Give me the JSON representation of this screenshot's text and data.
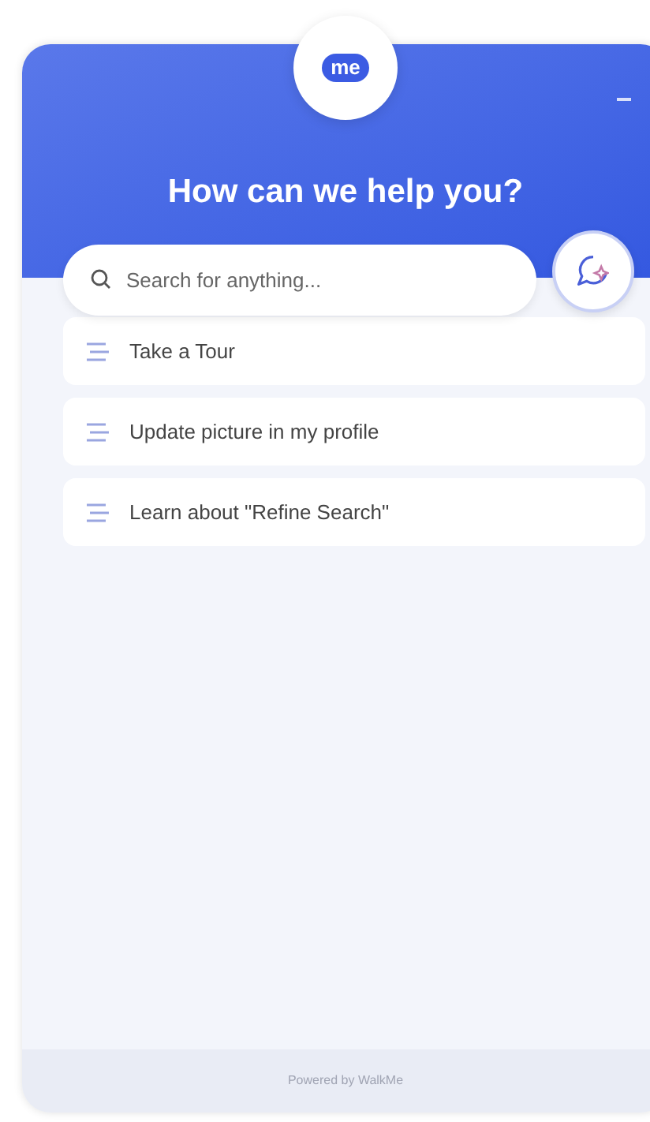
{
  "logo": {
    "text": "me"
  },
  "header": {
    "title": "How can we help you?"
  },
  "search": {
    "placeholder": "Search for anything..."
  },
  "items": [
    {
      "label": "Take a Tour"
    },
    {
      "label": "Update picture in my profile"
    },
    {
      "label": "Learn about \"Refine Search\""
    }
  ],
  "footer": {
    "text": "Powered by WalkMe"
  }
}
